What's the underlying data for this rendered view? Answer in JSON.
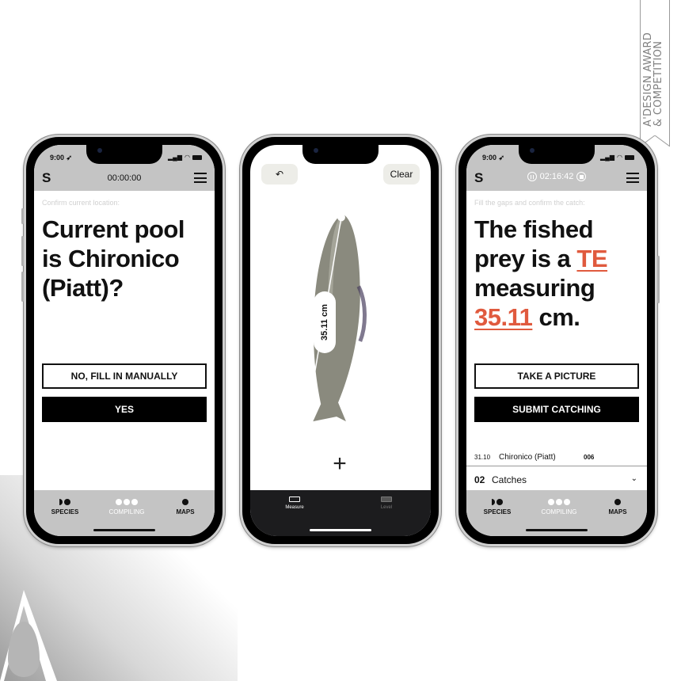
{
  "award": {
    "line1": "A'DESIGN AWARD",
    "line2": "& COMPETITION"
  },
  "phones": {
    "confirm_location": {
      "status_time": "9:00",
      "logo": "S",
      "timer": "00:00:00",
      "prompt": "Confirm current location:",
      "headline": "Current pool is Chironico (Piatt)?",
      "btn_secondary": "NO, FILL IN MANUALLY",
      "btn_primary": "YES"
    },
    "measure": {
      "back_icon": "undo-arrow-icon",
      "clear_label": "Clear",
      "measurement": "35.11 cm",
      "tabs": [
        {
          "label": "Measure",
          "active": true
        },
        {
          "label": "Level",
          "active": false
        }
      ]
    },
    "confirm_catch": {
      "status_time": "9:00",
      "logo": "S",
      "timer": "02:16:42",
      "prompt": "Fill the gaps and confirm the catch:",
      "headline_part1": "The fished prey is a ",
      "species": "TE",
      "headline_part2": " measuring ",
      "length": "35.11",
      "headline_part3": " cm.",
      "btn_secondary": "TAKE A PICTURE",
      "btn_primary": "SUBMIT CATCHING",
      "catch_row": {
        "date": "31.10",
        "location": "Chironico (Piatt)",
        "number": "006"
      },
      "catches": {
        "count": "02",
        "label": "Catches"
      }
    }
  },
  "tabbar": [
    {
      "label": "SPECIES",
      "icon": "species-icon",
      "active": false
    },
    {
      "label": "COMPILING",
      "icon": "compiling-icon",
      "active": true
    },
    {
      "label": "MAPS",
      "icon": "maps-icon",
      "active": false
    }
  ],
  "colors": {
    "accent": "#e05a3e",
    "header_gray": "#c4c4c4",
    "text": "#111111"
  }
}
